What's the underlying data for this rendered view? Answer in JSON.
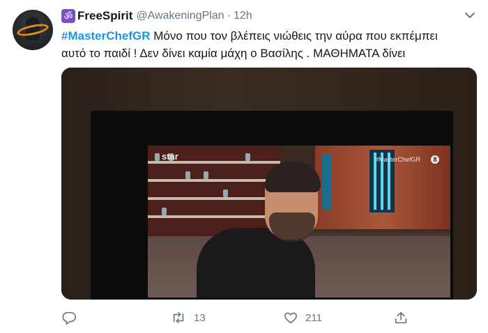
{
  "tweet": {
    "display_name": "FreeSpirit",
    "badge_glyph": "ॐ",
    "handle": "@AwakeningPlan",
    "separator": "·",
    "time": "12h",
    "hashtag": "#MasterChefGR",
    "text_line1": " Μόνο που τον βλέπεις νιώθεις την αύρα που εκπέμπει",
    "text_line2": "αυτό το παιδί ! Δεν δίνει καμία μάχη ο Βασίλης . ΜΑΘΗΜΑΤΑ δίνει"
  },
  "media": {
    "tv_channel_logo": "star",
    "tv_show_tag": "#MasterChefGR",
    "tv_channel_number": "8"
  },
  "actions": {
    "reply_count": "",
    "retweet_count": "13",
    "like_count": "211"
  },
  "icons": [
    "reply-icon",
    "retweet-icon",
    "like-icon",
    "share-icon",
    "caret-down-icon",
    "om-icon"
  ],
  "colors": {
    "link": "#1b95e0",
    "muted": "#657786",
    "text": "#14171a",
    "badge": "#7b4fc8"
  }
}
